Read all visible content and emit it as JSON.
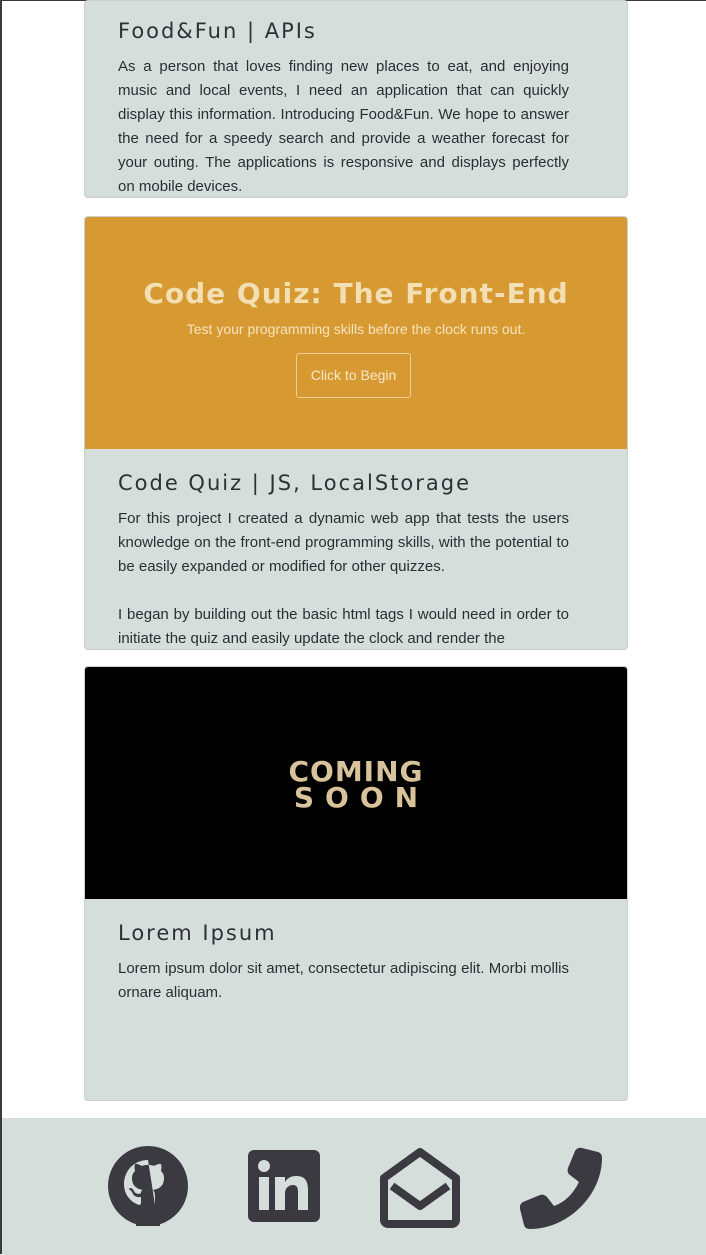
{
  "projects": [
    {
      "title": "Food&Fun | APIs",
      "paragraphs": [
        "As a person that loves finding new places to eat, and enjoying music and local events, I need an application that can quickly display this information. Introducing Food&Fun. We hope to answer the need for a speedy search and provide a weather forecast for your outing. The applications is responsive and displays perfectly on mobile devices."
      ]
    },
    {
      "title": "Code Quiz | JS, LocalStorage",
      "preview": {
        "heading": "Code Quiz: The Front-End",
        "subheading": "Test your programming skills before the clock runs out.",
        "button": "Click to Begin",
        "color": "#d79a33"
      },
      "paragraphs": [
        "For this project I created a dynamic web app that tests the users knowledge on the front-end programming skills, with the potential to be easily expanded or modified for other quizzes.",
        "I began by building out the basic html tags I would need in order to initiate the quiz and easily update the clock and render the"
      ]
    },
    {
      "title": "Lorem Ipsum",
      "preview": {
        "line1": "COMING",
        "line2": "SOON",
        "color": "#000000"
      },
      "paragraphs": [
        "Lorem ipsum dolor sit amet, consectetur adipiscing elit. Morbi mollis ornare aliquam."
      ]
    }
  ],
  "footer": {
    "icons": [
      "github-icon",
      "linkedin-icon",
      "email-icon",
      "phone-icon"
    ]
  },
  "colors": {
    "card_bg": "#d6dedb",
    "text": "#2c2d30",
    "icon": "#3a3a40"
  }
}
